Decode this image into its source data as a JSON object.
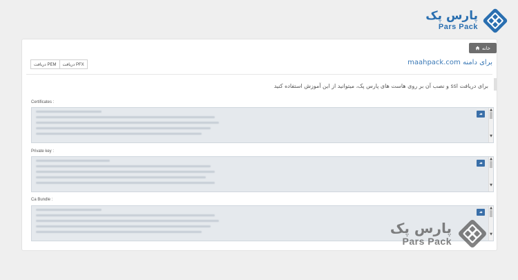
{
  "logo": {
    "text_fa": "پارس پک",
    "text_en": "Pars Pack"
  },
  "breadcrumb": {
    "home_label": "خانه"
  },
  "domain_title": "برای دامنه maahpack.com",
  "downloads": {
    "pfx_label": "دریافت PFX",
    "pem_label": "دریافت PEM"
  },
  "instructions": "برای دریافت ssl و نصب آن بر روی هاست های پارس پک، میتوانید از این آموزش استفاده کنید",
  "fields": [
    {
      "label": "Certificates :"
    },
    {
      "label": "Private key :"
    },
    {
      "label": "Ca Bundle :"
    }
  ],
  "watermark": {
    "text_fa": "پارس پک",
    "text_en": "Pars Pack"
  },
  "colors": {
    "brand_blue": "#2a6fb0",
    "link_blue": "#3b79b6",
    "copy_button": "#3a6fa8"
  },
  "icons": {
    "home": "home-icon",
    "copy": "copy-icon",
    "logo": "parspack-logo-icon"
  }
}
